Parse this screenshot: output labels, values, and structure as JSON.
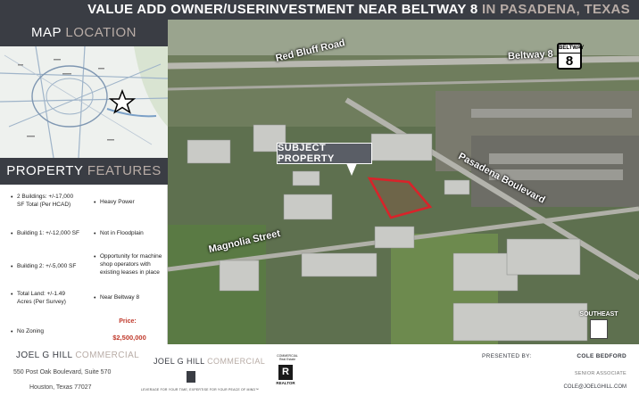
{
  "header": {
    "title_main": "VALUE ADD OWNER/USERINVESTMENT NEAR BELTWAY 8",
    "title_accent": " IN PASADENA, TEXAS"
  },
  "map_panel": {
    "title_main": "MAP ",
    "title_accent": "LOCATION"
  },
  "features_panel": {
    "title_main": "PROPERTY ",
    "title_accent": "FEATURES",
    "left_items": [
      "2 Buildings: +/-17,000 SF Total (Per HCAD)",
      "Building 1: +/-12,000 SF",
      "Building 2: +/-5,000 SF",
      "Total Land: +/-1.49 Acres (Per Survey)",
      "No Zoning"
    ],
    "right_items": [
      "Heavy Power",
      "Not in Floodplain",
      "Opportunity for machine shop operators with existing leases in place",
      "Near Beltway 8"
    ],
    "price_label": "Price:",
    "price_value": "$2,500,000"
  },
  "aerial": {
    "road_labels": {
      "red_bluff": "Red Bluff Road",
      "beltway": "Beltway 8",
      "pasadena": "Pasadena Boulevard",
      "magnolia": "Magnolia Street"
    },
    "beltway_shield": {
      "top": "BELTWAY",
      "number": "8"
    },
    "subject_label": "SUBJECT PROPERTY",
    "compass_label": "SOUTHEAST"
  },
  "footer": {
    "company_main": "JOEL G HILL ",
    "company_accent": "COMMERCIAL",
    "address_line1": "550 Post Oak Boulevard, Suite 570",
    "address_line2": "Houston, Texas 77027",
    "logo_main": "JOEL G HILL ",
    "logo_accent": "COMMERCIAL",
    "tagline": "LEVERAGE FOR YOUR TIME, EXPERTISE FOR YOUR PEACE OF MIND™",
    "realtor_top": "COMMERCIAL Real Estate",
    "realtor_letter": "R",
    "realtor_word": "REALTOR",
    "presented_by": "PRESENTED BY:",
    "agent_name": "COLE BEDFORD",
    "agent_role": "SENIOR ASSOCIATE",
    "agent_email": "COLE@JOELGHILL.COM"
  },
  "colors": {
    "banner": "#3a3d44",
    "accent": "#b8aca6",
    "price": "#c0392b",
    "property_outline": "#d9232a"
  }
}
